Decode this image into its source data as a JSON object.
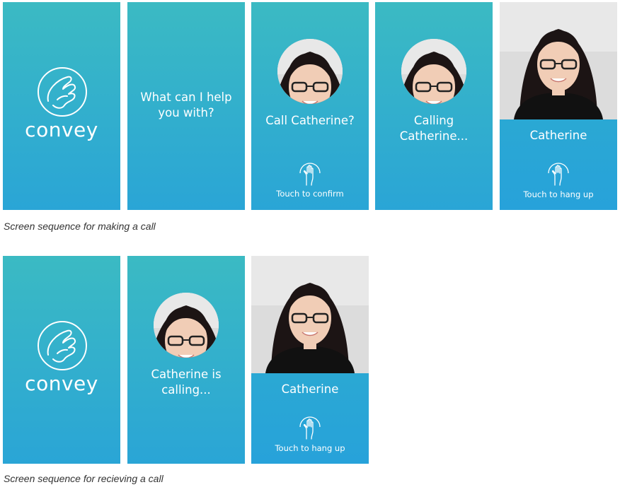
{
  "colors": {
    "gradient_top": "#3bbac3",
    "gradient_bottom": "#2aa5d6",
    "text": "#ffffff",
    "caption_text": "#333333"
  },
  "icons": {
    "logo": "hand-in-circle-icon",
    "touch": "raised-hand-icon"
  },
  "making_call": {
    "caption": "Screen sequence for making a call",
    "logo_screen": {
      "logo_text": "convey"
    },
    "prompt_screen": {
      "prompt": "What can I help\nyou with?"
    },
    "confirm_screen": {
      "prompt": "Call Catherine?",
      "action": "Touch to confirm"
    },
    "calling_screen": {
      "prompt": "Calling\nCatherine..."
    },
    "incall_screen": {
      "name": "Catherine",
      "action": "Touch to hang up"
    }
  },
  "receiving_call": {
    "caption": "Screen sequence for recieving a call",
    "logo_screen": {
      "logo_text": "convey"
    },
    "incoming_screen": {
      "prompt": "Catherine is\ncalling..."
    },
    "incall_screen": {
      "name": "Catherine",
      "action": "Touch to hang up"
    }
  }
}
